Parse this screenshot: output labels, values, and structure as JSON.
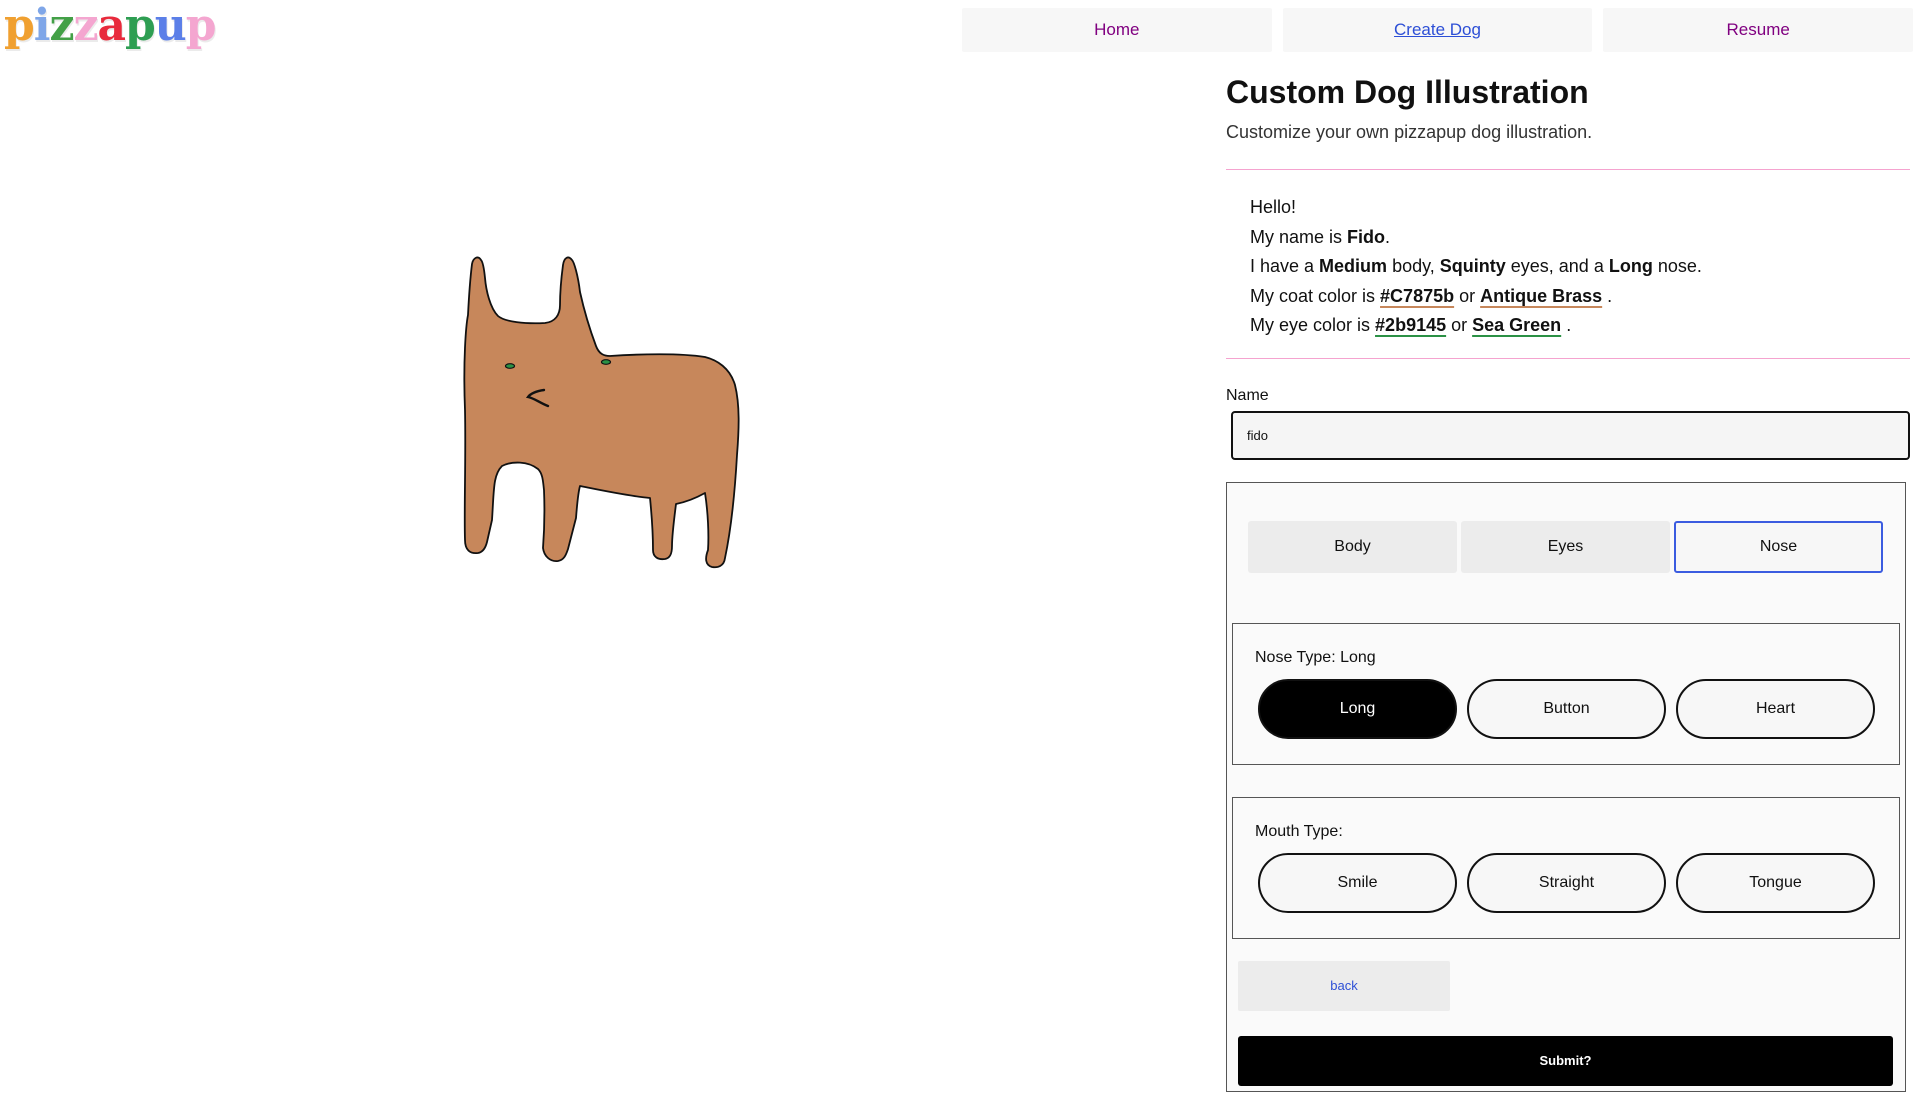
{
  "logo": {
    "letters": [
      "p",
      "i",
      "z",
      "z",
      "a",
      "p",
      "u",
      "p"
    ],
    "colors": [
      "#f0a030",
      "#7fa6e8",
      "#43a047",
      "#f4a6d0",
      "#e82a3c",
      "#2e9e52",
      "#5b7fe8",
      "#f4a6d0"
    ]
  },
  "nav": {
    "home": "Home",
    "create": "Create Dog",
    "resume": "Resume"
  },
  "page": {
    "title": "Custom Dog Illustration",
    "subtitle": "Customize your own pizzapup dog illustration."
  },
  "intro": {
    "hello": "Hello!",
    "name_prefix": "My name is ",
    "name": "Fido",
    "name_suffix": ".",
    "have_prefix": "I have a ",
    "body": "Medium",
    "body_suffix": " body, ",
    "eyes": "Squinty",
    "eyes_suffix": " eyes, and a ",
    "nose": "Long",
    "nose_suffix": " nose.",
    "coat_prefix": "My coat color is ",
    "coat_hex": "#C7875b",
    "coat_or": " or ",
    "coat_name": "Antique Brass",
    "coat_suffix": " .",
    "eye_prefix": "My eye color is ",
    "eye_hex": "#2b9145",
    "eye_or": " or ",
    "eye_name": "Sea Green",
    "eye_suffix": " ."
  },
  "form": {
    "name_label": "Name",
    "name_value": "fido",
    "tabs": [
      "Body",
      "Eyes",
      "Nose"
    ],
    "nose_label": "Nose Type: Long",
    "nose_options": [
      "Long",
      "Button",
      "Heart"
    ],
    "mouth_label": "Mouth Type:",
    "mouth_options": [
      "Smile",
      "Straight",
      "Tongue"
    ],
    "back": "back",
    "submit": "Submit?"
  },
  "dog": {
    "coat_color": "#c7875b",
    "eye_color": "#2b9145"
  },
  "accent": {
    "divider": "#f5a3cf",
    "link_blue": "#2d4fd6",
    "nav_purple": "#800080"
  }
}
